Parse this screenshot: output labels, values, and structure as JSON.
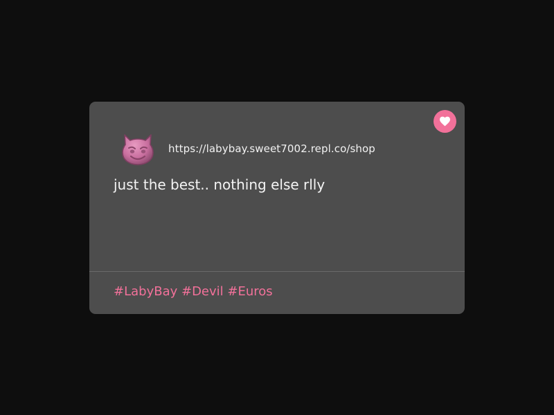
{
  "post": {
    "url": "https://labybay.sweet7002.repl.co/shop",
    "text": "just the best.. nothing else rlly",
    "tags": [
      "#LabyBay",
      "#Devil",
      "#Euros"
    ],
    "avatar_icon": "devil-face-pill",
    "like_icon": "heart-icon"
  },
  "colors": {
    "background": "#0e0e0e",
    "card": "#4d4d4d",
    "accent": "#f2719a",
    "text": "#f4f4f4"
  }
}
